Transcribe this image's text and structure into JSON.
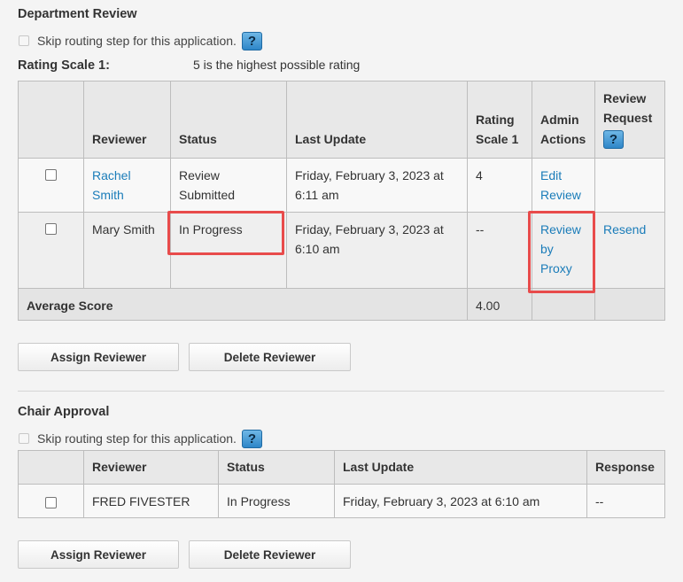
{
  "department": {
    "title": "Department Review",
    "skip_label": "Skip routing step for this application.",
    "rating_scale_label": "Rating Scale 1:",
    "rating_scale_note": "5 is the highest possible rating",
    "headers": {
      "reviewer": "Reviewer",
      "status": "Status",
      "last_update": "Last Update",
      "rating_line1": "Rating",
      "rating_line2": "Scale 1",
      "admin_line1": "Admin",
      "admin_line2": "Actions",
      "request_line1": "Review",
      "request_line2": "Request"
    },
    "rows": [
      {
        "reviewer": "Rachel Smith",
        "status": "Review Submitted",
        "last_update": "Friday, February 3, 2023 at 6:11 am",
        "rating": "4",
        "admin_action": "Edit Review",
        "request_action": ""
      },
      {
        "reviewer": "Mary Smith",
        "status": "In Progress",
        "last_update": "Friday, February 3, 2023 at 6:10 am",
        "rating": "--",
        "admin_action": "Review by Proxy",
        "request_action": "Resend"
      }
    ],
    "average_label": "Average Score",
    "average_value": "4.00",
    "assign_button": "Assign Reviewer",
    "delete_button": "Delete Reviewer"
  },
  "chair": {
    "title": "Chair Approval",
    "skip_label": "Skip routing step for this application.",
    "headers": {
      "reviewer": "Reviewer",
      "status": "Status",
      "last_update": "Last Update",
      "response": "Response"
    },
    "rows": [
      {
        "reviewer": "FRED FIVESTER",
        "status": "In Progress",
        "last_update": "Friday, February 3, 2023 at 6:10 am",
        "response": "--"
      }
    ],
    "assign_button": "Assign Reviewer",
    "delete_button": "Delete Reviewer"
  },
  "help_glyph": "?",
  "colors": {
    "link": "#1a7cb9",
    "highlight": "#e84b4b",
    "help_button": "#2e86c8"
  }
}
